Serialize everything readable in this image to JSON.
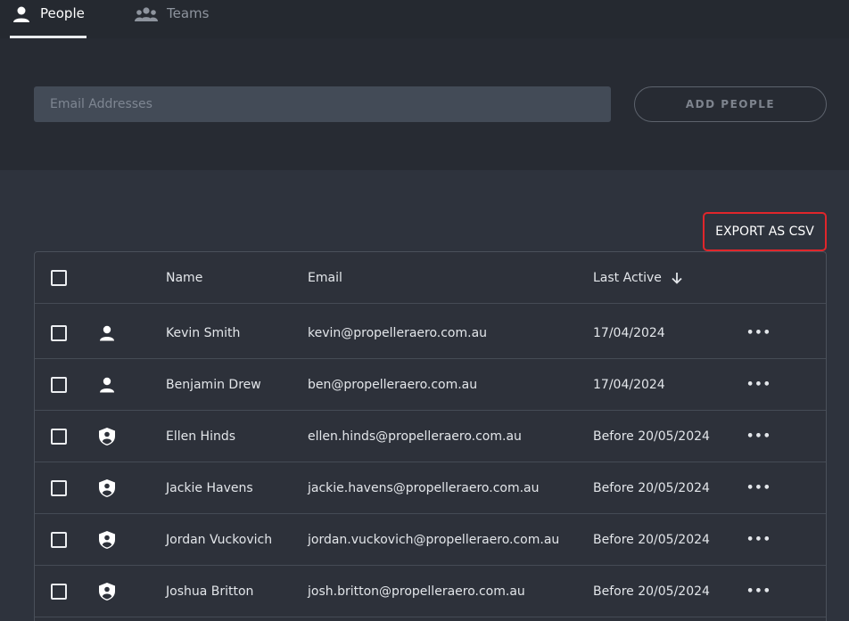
{
  "tabs": {
    "people_label": "People",
    "teams_label": "Teams"
  },
  "add_people": {
    "placeholder": "Email Addresses",
    "button_label": "ADD PEOPLE"
  },
  "export_label": "EXPORT AS CSV",
  "table": {
    "headers": {
      "name": "Name",
      "email": "Email",
      "last_active": "Last Active"
    },
    "rows": [
      {
        "name": "Kevin Smith",
        "email": "kevin@propelleraero.com.au",
        "last_active": "17/04/2024",
        "icon": "person-icon"
      },
      {
        "name": "Benjamin Drew",
        "email": "ben@propelleraero.com.au",
        "last_active": "17/04/2024",
        "icon": "person-icon"
      },
      {
        "name": "Ellen Hinds",
        "email": "ellen.hinds@propelleraero.com.au",
        "last_active": "Before 20/05/2024",
        "icon": "shield-user-icon"
      },
      {
        "name": "Jackie Havens",
        "email": "jackie.havens@propelleraero.com.au",
        "last_active": "Before 20/05/2024",
        "icon": "shield-user-icon"
      },
      {
        "name": "Jordan Vuckovich",
        "email": "jordan.vuckovich@propelleraero.com.au",
        "last_active": "Before 20/05/2024",
        "icon": "shield-user-icon"
      },
      {
        "name": "Joshua Britton",
        "email": "josh.britton@propelleraero.com.au",
        "last_active": "Before 20/05/2024",
        "icon": "shield-user-icon"
      }
    ],
    "row_menu_label": "•••"
  },
  "colors": {
    "page_bg": "#2e333d",
    "tabbar_bg": "#252930",
    "panel_bg": "#272b33",
    "input_bg": "#434b57",
    "highlight": "#e0262b"
  }
}
